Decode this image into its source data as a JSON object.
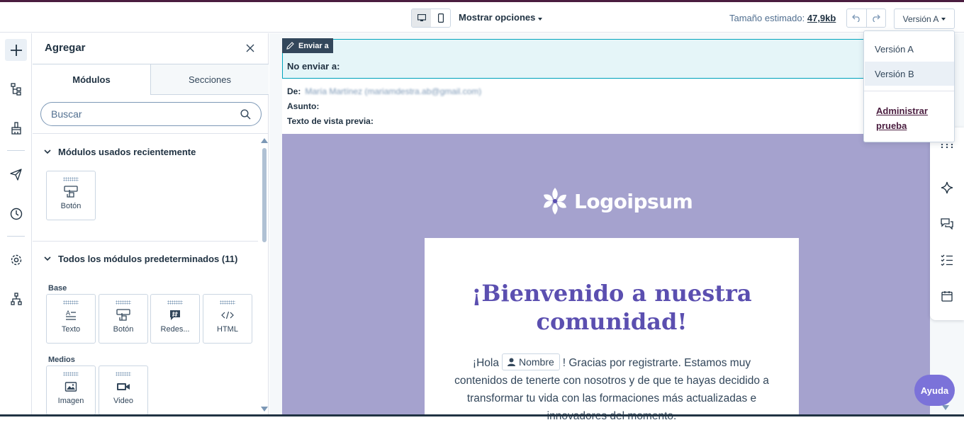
{
  "topbar": {
    "show_options": "Mostrar opciones",
    "size_label": "Tamaño estimado:",
    "size_value": "47,9kb",
    "version_button": "Versión A"
  },
  "version_menu": {
    "items": [
      "Versión A",
      "Versión B"
    ],
    "manage_link_line1": "Administrar",
    "manage_link_line2": "prueba"
  },
  "panel": {
    "title": "Agregar",
    "tabs": [
      "Módulos",
      "Secciones"
    ],
    "search_placeholder": "Buscar",
    "recent_heading": "Módulos usados recientemente",
    "recent_modules": [
      {
        "label": "Botón",
        "icon": "button-icon"
      }
    ],
    "all_heading": "Todos los módulos predeterminados (11)",
    "group_base": "Base",
    "base_modules": [
      {
        "label": "Texto",
        "icon": "text-icon"
      },
      {
        "label": "Botón",
        "icon": "button-icon"
      },
      {
        "label": "Redes...",
        "icon": "social-icon"
      },
      {
        "label": "HTML",
        "icon": "html-icon"
      }
    ],
    "group_media": "Medios",
    "media_modules": [
      {
        "label": "Imagen",
        "icon": "image-icon"
      },
      {
        "label": "Video",
        "icon": "video-icon"
      }
    ]
  },
  "send": {
    "tag": "Enviar a",
    "no_send": "No enviar a:"
  },
  "meta": {
    "from_label": "De:",
    "from_value": "María Martínez (mariamdestra.ab@gmail.com)",
    "subject_label": "Asunto:",
    "preview_label": "Texto de vista previa:"
  },
  "email": {
    "logo_text": "Logoipsum",
    "headline": "¡Bienvenido a nuestra comunidad!",
    "greeting": "¡Hola",
    "token": "Nombre",
    "body_after": "! Gracias por registrarte. Estamos muy contenidos de tenerte con nosotros y de que te hayas decidido a transformar tu vida con las formaciones más actualizadas e innovadores del momento."
  },
  "help_label": "Ayuda"
}
